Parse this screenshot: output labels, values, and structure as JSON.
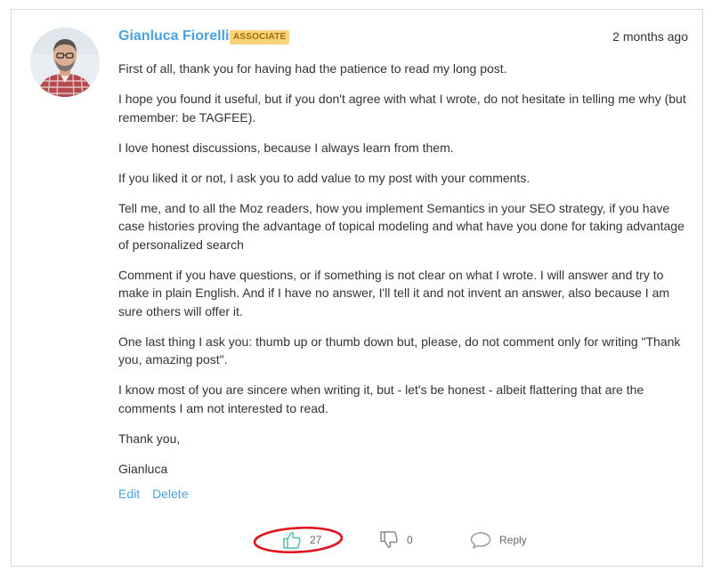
{
  "comment": {
    "author": "Gianluca Fiorelli",
    "badge": "ASSOCIATE",
    "timestamp": "2 months ago",
    "paragraphs": [
      "First of all, thank you for having had the patience to read my long post.",
      "I hope you found it useful, but if you don't agree with what I wrote, do not hesitate in telling me why (but remember: be TAGFEE).",
      "I love honest discussions, because I always learn from them.",
      "If you liked it or not, I ask you to add value to my post with your comments.",
      "Tell me, and to all the Moz readers, how you implement Semantics in your SEO strategy, if you have case histories proving the advantage of topical modeling and what have you done for taking advantage of personalized search",
      "Comment if you have questions, or if something is not clear on what I wrote. I will answer and try to make in plain English. And if I have no answer, I'll tell it and not invent an answer, also because I am sure others will offer it.",
      "One last thing I ask you: thumb up or thumb down but, please, do not comment only for writing \"Thank you, amazing post\".",
      "I know most of you are sincere when writing it, but - let's be honest - albeit flattering that are the comments I am not interested to read.",
      "Thank you,",
      "Gianluca"
    ],
    "actions": {
      "edit": "Edit",
      "delete": "Delete"
    },
    "votes": {
      "up_count": "27",
      "down_count": "0",
      "reply_label": "Reply"
    }
  },
  "icons": {
    "thumbs_up": "thumbs-up-icon",
    "thumbs_down": "thumbs-down-icon",
    "reply": "speech-bubble-icon"
  },
  "colors": {
    "link": "#4aa3df",
    "badge_bg": "#fbd37a",
    "badge_text": "#a26b00",
    "annotation": "#e0121b",
    "thumb_up": "#5bb9a4"
  }
}
